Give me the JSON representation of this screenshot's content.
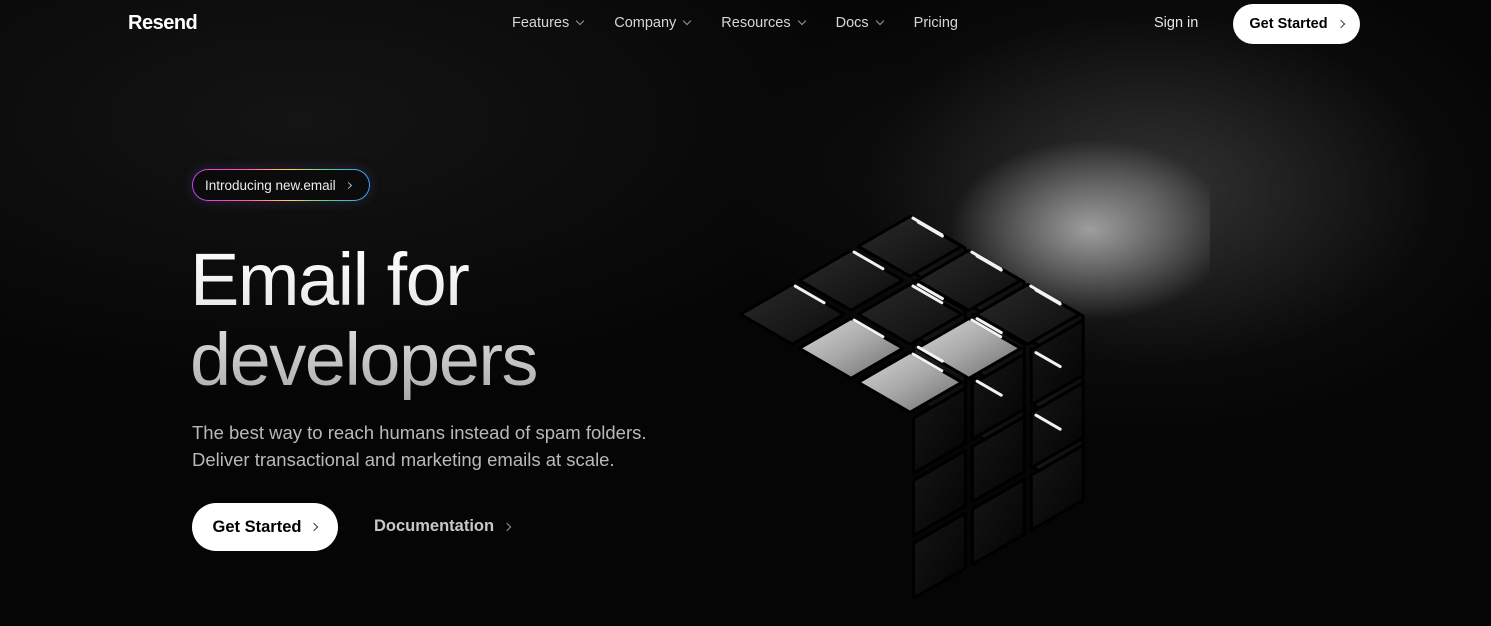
{
  "nav": {
    "logo": "Resend",
    "links": [
      {
        "label": "Features",
        "dropdown": true
      },
      {
        "label": "Company",
        "dropdown": true
      },
      {
        "label": "Resources",
        "dropdown": true
      },
      {
        "label": "Docs",
        "dropdown": true
      },
      {
        "label": "Pricing",
        "dropdown": false
      }
    ],
    "signin": "Sign in",
    "cta": "Get Started"
  },
  "hero": {
    "pill": "Introducing new.email",
    "headline_line1": "Email for",
    "headline_line2": "developers",
    "sub_line1": "The best way to reach humans instead of spam folders.",
    "sub_line2": "Deliver transactional and marketing emails at scale.",
    "cta": "Get Started",
    "docs_link": "Documentation"
  },
  "icons": {
    "dropdown": "chevron-down-icon",
    "cta_arrow": "chevron-right-icon",
    "illustration": "cube-icon"
  },
  "colors": {
    "background": "#000000",
    "cta_bg": "#ffffff",
    "cta_text": "#000000"
  }
}
